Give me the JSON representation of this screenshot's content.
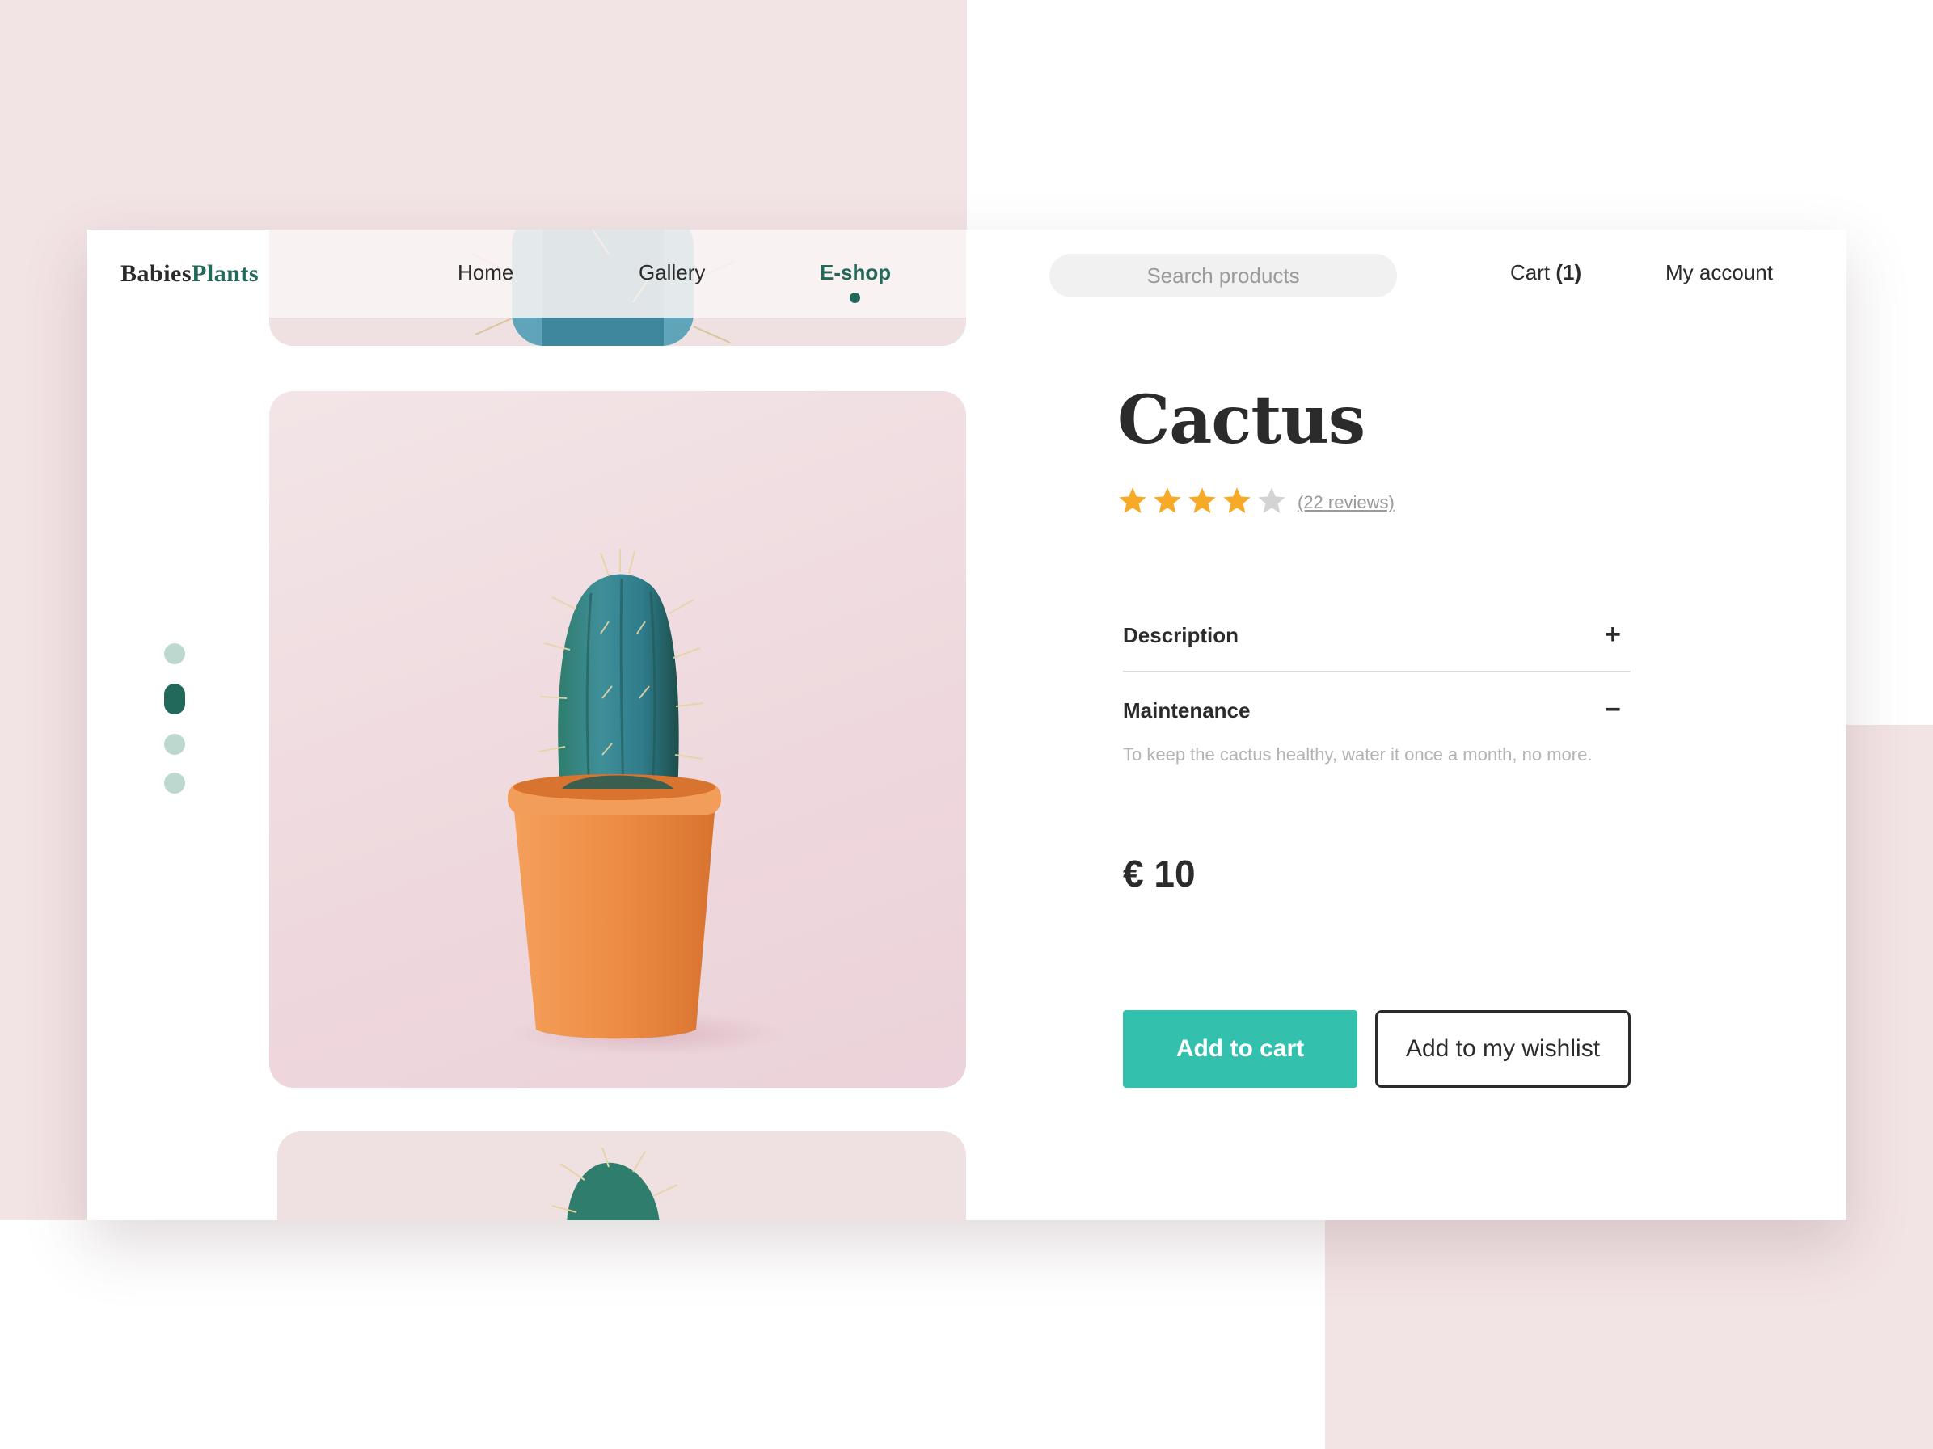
{
  "brand": {
    "part1": "Babies",
    "part2": "Plants"
  },
  "nav": {
    "items": [
      {
        "label": "Home"
      },
      {
        "label": "Gallery"
      },
      {
        "label": "E-shop",
        "active": true
      }
    ]
  },
  "search": {
    "placeholder": "Search products"
  },
  "header": {
    "cart_label": "Cart",
    "cart_count": "(1)",
    "account_label": "My account"
  },
  "gallery": {
    "slides": 4,
    "active_slide": 2
  },
  "product": {
    "name": "Cactus",
    "rating": 4,
    "rating_max": 5,
    "reviews_label": "(22 reviews)",
    "price": "€ 10"
  },
  "accordion": {
    "description": {
      "title": "Description",
      "toggle": "+",
      "expanded": false
    },
    "maintenance": {
      "title": "Maintenance",
      "toggle": "−",
      "expanded": true,
      "body": "To keep the cactus healthy, water it once a month, no more."
    }
  },
  "actions": {
    "add_to_cart": "Add to cart",
    "add_to_wishlist": "Add to my wishlist"
  },
  "colors": {
    "brand_green": "#23695a",
    "accent_teal": "#33c0ad",
    "star": "#f7a928",
    "star_empty": "#d3d3d3",
    "bg_pink": "#f2e3e4"
  }
}
